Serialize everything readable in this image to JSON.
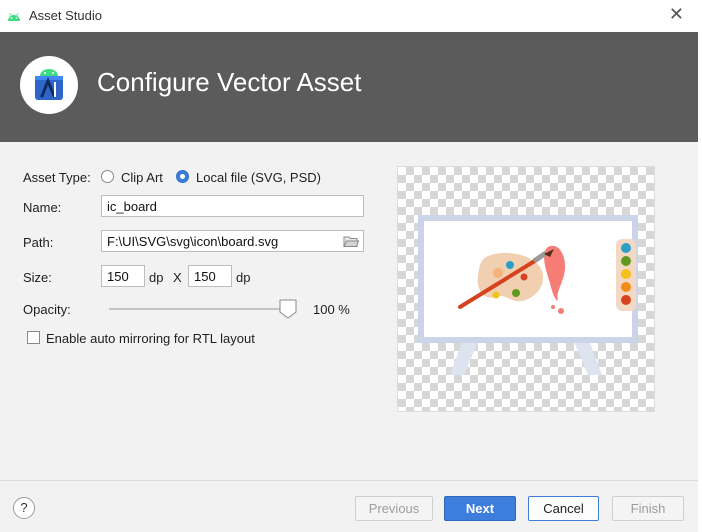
{
  "window": {
    "title": "Asset Studio",
    "close_glyph": "✕"
  },
  "header": {
    "heading": "Configure Vector Asset",
    "bg_color": "#5b5b5b"
  },
  "form": {
    "asset_type_label": "Asset Type:",
    "asset_type_options": [
      {
        "label": "Clip Art",
        "selected": false
      },
      {
        "label": "Local file (SVG, PSD)",
        "selected": true
      }
    ],
    "name_label": "Name:",
    "name_value": "ic_board",
    "path_label": "Path:",
    "path_value": "F:\\UI\\SVG\\svg\\icon\\board.svg",
    "size_label": "Size:",
    "size_width": "150",
    "size_width_unit": "dp",
    "size_separator": "X",
    "size_height": "150",
    "size_height_unit": "dp",
    "opacity_label": "Opacity:",
    "opacity_value": "100 %",
    "opacity_level": 1.0,
    "mirroring_label": "Enable auto mirroring for RTL layout",
    "mirroring_checked": false
  },
  "icons": {
    "app": "android-studio-icon",
    "logo": "android-studio-logo",
    "folder": "folder-open-icon",
    "help": "help-icon",
    "preview": "board-palette-illustration"
  },
  "footer": {
    "help_label": "?",
    "previous_label": "Previous",
    "next_label": "Next",
    "cancel_label": "Cancel",
    "finish_label": "Finish"
  },
  "colors": {
    "accent": "#3d7ddb",
    "android_green": "#3ddc84"
  }
}
